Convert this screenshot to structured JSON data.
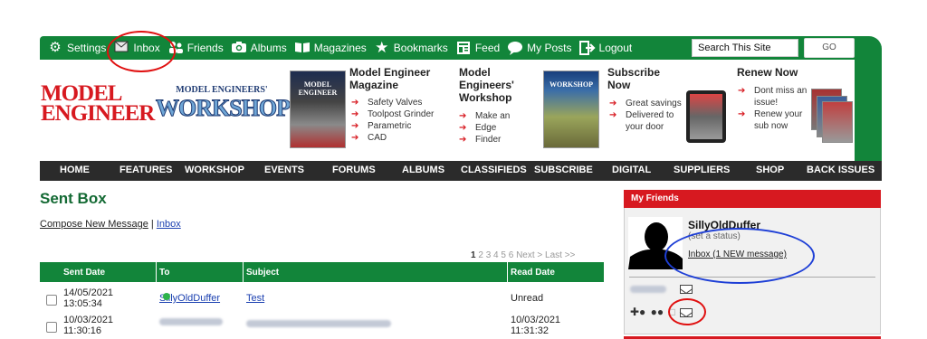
{
  "topnav": {
    "items": [
      {
        "label": "Settings",
        "icon": "gear-icon"
      },
      {
        "label": "Inbox",
        "icon": "envelope-icon"
      },
      {
        "label": "Friends",
        "icon": "friends-icon"
      },
      {
        "label": "Albums",
        "icon": "camera-icon"
      },
      {
        "label": "Magazines",
        "icon": "book-icon"
      },
      {
        "label": "Bookmarks",
        "icon": "star-icon"
      },
      {
        "label": "Feed",
        "icon": "feed-icon"
      },
      {
        "label": "My Posts",
        "icon": "speech-bubble-icon"
      },
      {
        "label": "Logout",
        "icon": "logout-icon"
      }
    ],
    "search_value": "Search This Site",
    "go_label": "GO"
  },
  "banner": {
    "logo_me_line1": "MODEL",
    "logo_me_line2": "ENGINEER",
    "logo_mew_small": "MODEL ENGINEERS'",
    "logo_mew_big": "WORKSHOP",
    "cover1_title": "MODEL ENGINEER",
    "cover2_title": "WORKSHOP",
    "promo1": {
      "title": "Model Engineer Magazine",
      "items": [
        "Safety Valves",
        "Toolpost Grinder",
        "Parametric",
        "CAD"
      ]
    },
    "promo2": {
      "title": "Model Engineers' Workshop",
      "items": [
        "Make an",
        "Edge",
        "Finder"
      ]
    },
    "promo3": {
      "title": "Subscribe Now",
      "items": [
        "Great savings",
        "Delivered to your door"
      ]
    },
    "promo4": {
      "title": "Renew Now",
      "items": [
        "Dont miss an issue!",
        "Renew your sub now"
      ]
    }
  },
  "mainnav": [
    "HOME",
    "FEATURES",
    "WORKSHOP",
    "EVENTS",
    "FORUMS",
    "ALBUMS",
    "CLASSIFIEDS",
    "SUBSCRIBE",
    "DIGITAL",
    "SUPPLIERS",
    "SHOP",
    "BACK ISSUES"
  ],
  "content": {
    "title": "Sent Box",
    "compose_label": "Compose New Message",
    "separator": "|",
    "inbox_label": "Inbox",
    "pager": {
      "current": "1",
      "pages": [
        "2",
        "3",
        "4",
        "5",
        "6"
      ],
      "next": "Next >",
      "last": "Last >>"
    },
    "table": {
      "headers": [
        "Sent Date",
        "To",
        "Subject",
        "Read Date"
      ],
      "rows": [
        {
          "date": "14/05/2021",
          "time": "13:05:34",
          "to": "SillyOldDuffer",
          "subject": "Test",
          "read_date": "Unread",
          "read_time": ""
        },
        {
          "date": "10/03/2021",
          "time": "11:30:16",
          "to": "",
          "subject": "",
          "read_date": "10/03/2021",
          "read_time": "11:31:32"
        }
      ]
    }
  },
  "friends": {
    "header": "My Friends",
    "name": "SillyOldDuffer",
    "status": "(set a status)",
    "inbox_link": "Inbox (1 NEW message)"
  },
  "colors": {
    "green": "#12853a",
    "red": "#d71920",
    "dark": "#2b2b2b",
    "annotation_red": "#e01010",
    "annotation_blue": "#1e3fd6"
  }
}
